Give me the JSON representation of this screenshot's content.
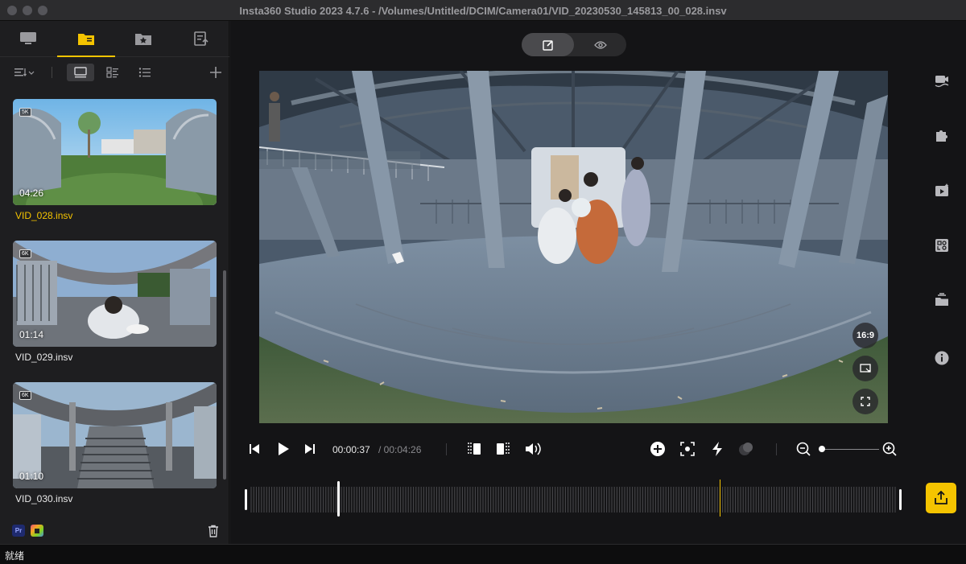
{
  "window": {
    "title": "Insta360 Studio 2023 4.7.6 - /Volumes/Untitled/DCIM/Camera01/VID_20230530_145813_00_028.insv"
  },
  "sidebar": {
    "tabs": [
      {
        "icon": "monitor-icon"
      },
      {
        "icon": "folder-icon",
        "active": true
      },
      {
        "icon": "star-folder-icon"
      },
      {
        "icon": "export-list-icon"
      }
    ],
    "thumbnails": [
      {
        "badge": "5K",
        "duration": "04:26",
        "name": "VID_028.insv",
        "active": true
      },
      {
        "badge": "6K",
        "duration": "01:14",
        "name": "VID_029.insv",
        "active": false
      },
      {
        "badge": "6K",
        "duration": "01:10",
        "name": "VID_030.insv",
        "active": false
      }
    ],
    "bottom": {
      "premiere_badge": "Pr"
    }
  },
  "viewer": {
    "aspect_label": "16:9"
  },
  "playback": {
    "current_time": "00:00:37",
    "total_time": "/ 00:04:26",
    "zoom_level": 0.05,
    "playhead_position": 0.72
  },
  "status": {
    "text": "就绪"
  },
  "colors": {
    "accent": "#f5c400",
    "background": "#141416",
    "sidebar": "#1e1e20"
  }
}
